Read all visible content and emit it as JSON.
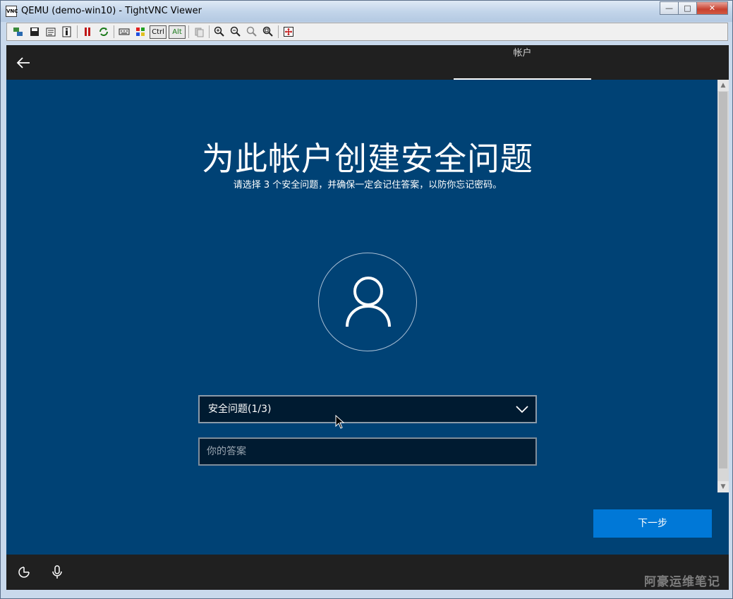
{
  "window": {
    "title": "QEMU (demo-win10) - TightVNC Viewer",
    "app_icon_text": "VNC",
    "minimize_glyph": "—",
    "maximize_glyph": "□",
    "close_glyph": "✕"
  },
  "toolbar": {
    "ctrl_label": "Ctrl",
    "alt_label": "Alt",
    "icons": [
      "new-connection-icon",
      "save-icon",
      "options-icon",
      "info-icon",
      "pause-icon",
      "refresh-icon",
      "ctrl-alt-del-icon",
      "ctrl-esc-icon",
      "ctrl-key",
      "alt-key",
      "clipboard-icon",
      "zoom-in-icon",
      "zoom-out-icon",
      "zoom-100-icon",
      "zoom-fit-icon",
      "fullscreen-icon"
    ]
  },
  "oobe": {
    "header": {
      "tab_label": "帐户"
    },
    "title": "为此帐户创建安全问题",
    "subtitle": "请选择 3 个安全问题，并确保一定会记住答案，以防你忘记密码。",
    "security_question": {
      "selected": "安全问题(1/3)"
    },
    "answer": {
      "placeholder": "你的答案",
      "value": ""
    },
    "next_label": "下一步"
  },
  "footer": {
    "watermark": "阿豪运维笔记"
  },
  "colors": {
    "background": "#004275",
    "header_bar": "#202020",
    "accent_button": "#0078d7",
    "field_bg": "#001b31"
  }
}
